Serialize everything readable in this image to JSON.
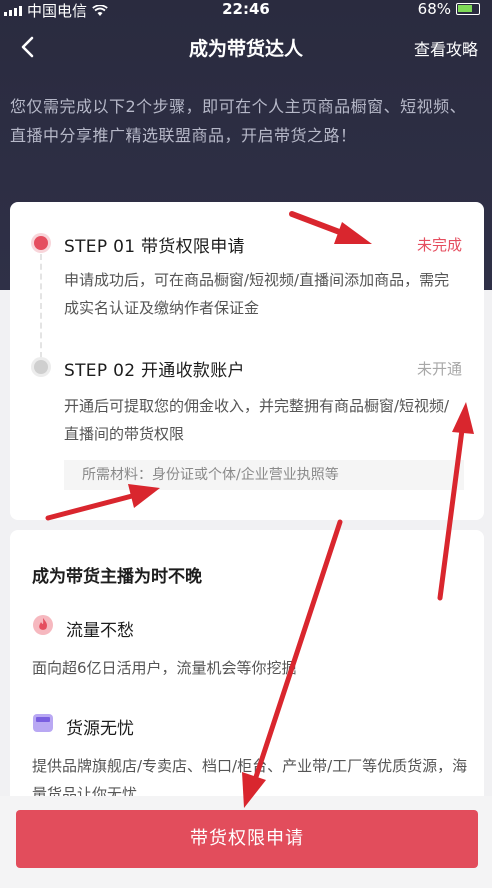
{
  "status_bar": {
    "carrier": "中国电信",
    "time": "22:46",
    "battery": "68%"
  },
  "nav": {
    "title": "成为带货达人",
    "guide_link": "查看攻略",
    "back_icon": "back-arrow-icon"
  },
  "intro_text": "您仅需完成以下2个步骤，即可在个人主页商品橱窗、短视频、直播中分享推广精选联盟商品，开启带货之路！",
  "steps": [
    {
      "title": "STEP 01 带货权限申请",
      "status": "未完成",
      "status_color": "#e54e5f",
      "description": "申请成功后，可在商品橱窗/短视频/直播间添加商品，需完成实名认证及缴纳作者保证金"
    },
    {
      "title": "STEP 02 开通收款账户",
      "status": "未开通",
      "status_color": "#a8a8a8",
      "description": "开通后可提取您的佣金收入，并完整拥有商品橱窗/短视频/直播间的带货权限",
      "materials": "所需材料：身份证或个体/企业营业执照等"
    }
  ],
  "benefits": {
    "heading": "成为带货主播为时不晚",
    "items": [
      {
        "icon": "flame-icon",
        "title": "流量不愁",
        "description": "面向超6亿日活用户，流量机会等你挖掘"
      },
      {
        "icon": "shop-bag-icon",
        "title": "货源无忧",
        "description": "提供品牌旗舰店/专卖店、档口/柜台、产业带/工厂等优质货源，海量货品让你无忧"
      }
    ]
  },
  "apply_button": "带货权限申请",
  "colors": {
    "accent": "#e24d5c",
    "header_bg": "#2a2b3f",
    "arrow": "#d9262e"
  }
}
